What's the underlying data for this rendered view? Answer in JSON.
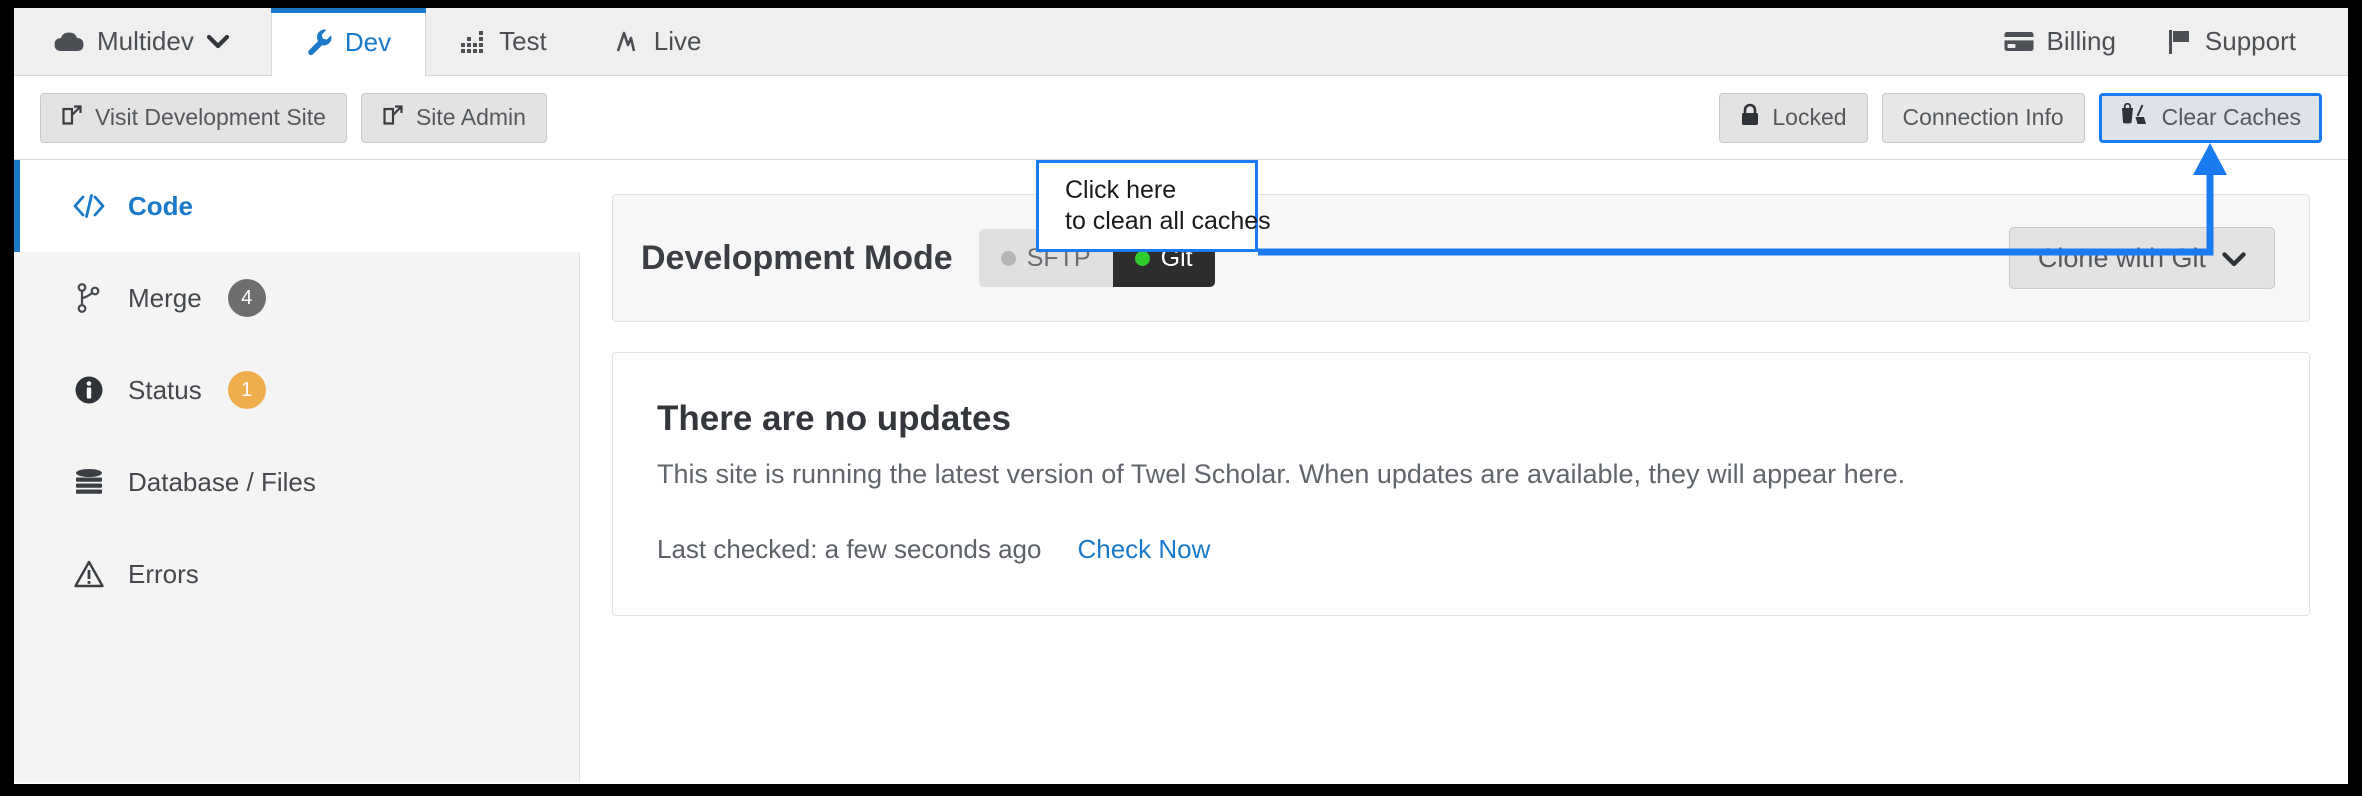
{
  "topnav": {
    "left_tabs": [
      {
        "label": "Multidev",
        "icon": "cloud-icon",
        "active": false,
        "caret": true
      },
      {
        "label": "Dev",
        "icon": "wrench-icon",
        "active": true,
        "caret": false
      },
      {
        "label": "Test",
        "icon": "chart-bars-icon",
        "active": false,
        "caret": false
      },
      {
        "label": "Live",
        "icon": "pulse-icon",
        "active": false,
        "caret": false
      }
    ],
    "right_tabs": [
      {
        "label": "Billing",
        "icon": "credit-card-icon"
      },
      {
        "label": "Support",
        "icon": "flag-icon"
      }
    ]
  },
  "toolbar": {
    "left_buttons": [
      {
        "label": "Visit Development Site",
        "icon": "external-link-icon"
      },
      {
        "label": "Site Admin",
        "icon": "external-link-icon"
      }
    ],
    "right_buttons": [
      {
        "label": "Locked",
        "icon": "lock-icon",
        "highlight": false
      },
      {
        "label": "Connection Info",
        "icon": "",
        "highlight": false
      },
      {
        "label": "Clear Caches",
        "icon": "broom-bucket-icon",
        "highlight": true
      }
    ]
  },
  "sidebar": {
    "items": [
      {
        "label": "Code",
        "icon": "code-icon",
        "active": true,
        "badge": null,
        "badge_color": null
      },
      {
        "label": "Merge",
        "icon": "branch-icon",
        "active": false,
        "badge": "4",
        "badge_color": "#6e6e6e"
      },
      {
        "label": "Status",
        "icon": "info-icon",
        "active": false,
        "badge": "1",
        "badge_color": "#f0ad4e"
      },
      {
        "label": "Database / Files",
        "icon": "database-icon",
        "active": false,
        "badge": null,
        "badge_color": null
      },
      {
        "label": "Errors",
        "icon": "warning-triangle-icon",
        "active": false,
        "badge": null,
        "badge_color": null
      }
    ]
  },
  "dev_mode": {
    "title": "Development Mode",
    "options": [
      {
        "label": "SFTP",
        "selected": false,
        "dot_color": "#b5b5b5"
      },
      {
        "label": "Git",
        "selected": true,
        "dot_color": "#2ecc2e"
      }
    ],
    "clone_button": "Clone with Git",
    "clone_caret": "chevron-down-icon"
  },
  "updates": {
    "title": "There are no updates",
    "description": "This site is running the latest version of Twel Scholar. When updates are available, they will appear here.",
    "last_checked": "Last checked: a few seconds ago",
    "check_now": "Check Now"
  },
  "callout": {
    "line1": "Click here",
    "line2": "to clean all caches",
    "border_color": "#1a7bf0",
    "arrow_color": "#1a7bf0",
    "target": "clear-caches-button"
  },
  "colors": {
    "accent_blue": "#1a79c8",
    "highlight_blue": "#1a7bf0",
    "badge_gray": "#6e6e6e",
    "badge_orange": "#f0ad4e",
    "git_green": "#2ecc2e"
  }
}
